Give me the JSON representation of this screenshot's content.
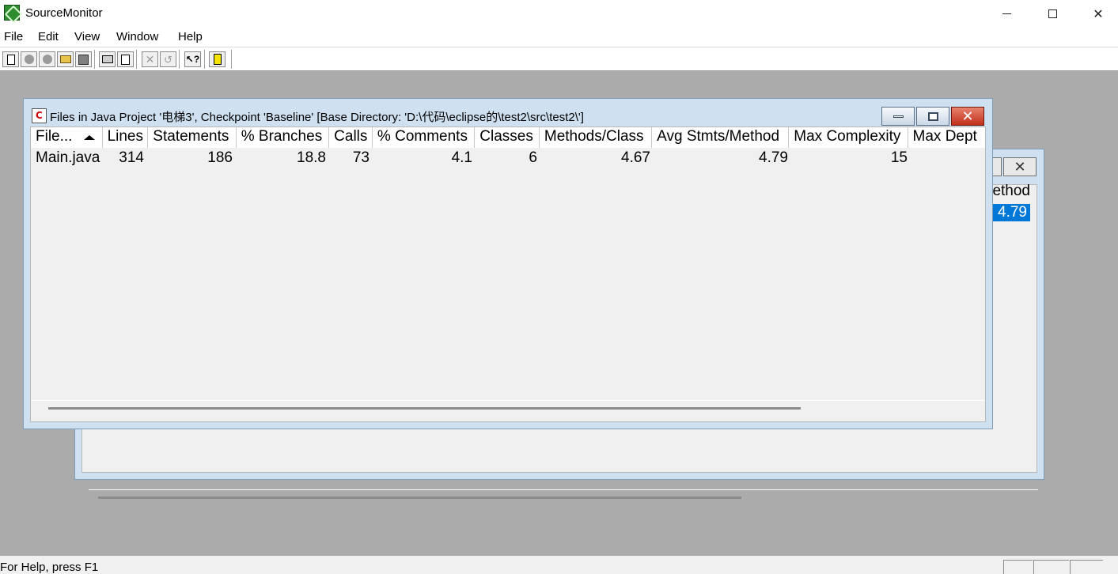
{
  "app": {
    "title": "SourceMonitor",
    "window_controls": {
      "minimize": "–",
      "maximize": "□",
      "close": "✕"
    }
  },
  "menu": {
    "items": [
      "File",
      "Edit",
      "View",
      "Window",
      "Help"
    ]
  },
  "toolbar": {
    "buttons": [
      {
        "name": "new-icon",
        "enabled": true
      },
      {
        "name": "record-icon",
        "enabled": false
      },
      {
        "name": "checkpoint-icon",
        "enabled": false
      },
      {
        "name": "open-folder-icon",
        "enabled": true
      },
      {
        "name": "save-icon",
        "enabled": false
      },
      {
        "name": "print-icon",
        "enabled": true
      },
      {
        "name": "print-preview-icon",
        "enabled": true
      },
      {
        "name": "delete-icon",
        "enabled": false
      },
      {
        "name": "undo-icon",
        "enabled": false
      },
      {
        "name": "context-help-icon",
        "enabled": true
      },
      {
        "name": "flag-icon",
        "enabled": true
      }
    ]
  },
  "front_window": {
    "title": "Files in Java Project '电梯3', Checkpoint 'Baseline'  [Base Directory: 'D:\\代码\\eclipse的\\test2\\src\\test2\\']",
    "close_glyph": "✕",
    "icon_letter": "C",
    "columns": [
      "File...",
      "Lines",
      "Statements",
      "% Branches",
      "Calls",
      "% Comments",
      "Classes",
      "Methods/Class",
      "Avg Stmts/Method",
      "Max Complexity",
      "Max Dept"
    ],
    "sort_column": "File...",
    "rows": [
      {
        "file": "Main.java",
        "lines": "314",
        "statements": "186",
        "branches": "18.8",
        "calls": "73",
        "comments": "4.1",
        "classes": "6",
        "methods_per_class": "4.67",
        "avg_stmts_per_method": "4.79",
        "max_complexity": "15",
        "max_depth": ""
      }
    ]
  },
  "back_window": {
    "column_fragment": "Method",
    "selected_value": "4.79",
    "close_glyph": "✕"
  },
  "status": {
    "text": "For Help, press F1"
  }
}
